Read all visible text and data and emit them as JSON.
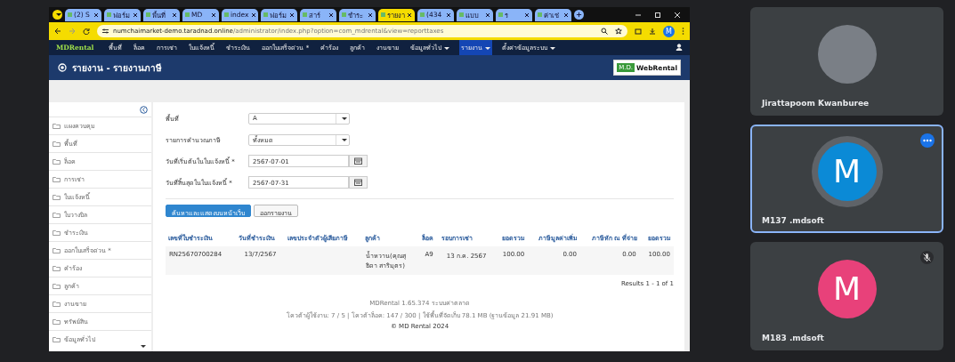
{
  "browser": {
    "tabs": [
      {
        "label": "(2) S",
        "selected": false
      },
      {
        "label": "ฟอร์ม",
        "selected": false
      },
      {
        "label": "พื้นที่",
        "selected": false
      },
      {
        "label": "MD",
        "selected": false
      },
      {
        "label": "index",
        "selected": false
      },
      {
        "label": "ฟอร์ม",
        "selected": false
      },
      {
        "label": "สาร์",
        "selected": false
      },
      {
        "label": "ชำระ",
        "selected": false
      },
      {
        "label": "รายงา",
        "selected": true
      },
      {
        "label": "(434",
        "selected": false
      },
      {
        "label": "แบบ",
        "selected": false
      },
      {
        "label": "ร",
        "selected": false
      },
      {
        "label": "ค่าเช่",
        "selected": false
      }
    ],
    "url_host": "numchaimarket-demo.taradnad.online",
    "url_path": "/administrator/index.php?option=com_mdrental&view=reporttaxes",
    "profile_initial": "M"
  },
  "app": {
    "brand": "MDRental",
    "menu": [
      {
        "label": "พื้นที่",
        "dropdown": false,
        "selected": false
      },
      {
        "label": "ล็อค",
        "dropdown": false,
        "selected": false
      },
      {
        "label": "การเช่า",
        "dropdown": false,
        "selected": false
      },
      {
        "label": "ใบแจ้งหนี้",
        "dropdown": false,
        "selected": false
      },
      {
        "label": "ชำระเงิน",
        "dropdown": false,
        "selected": false
      },
      {
        "label": "ออกใบเสร็จด่วน *",
        "dropdown": false,
        "selected": false
      },
      {
        "label": "คำร้อง",
        "dropdown": false,
        "selected": false
      },
      {
        "label": "ลูกค้า",
        "dropdown": false,
        "selected": false
      },
      {
        "label": "งานขาย",
        "dropdown": false,
        "selected": false
      },
      {
        "label": "ข้อมูลทั่วไป",
        "dropdown": true,
        "selected": false
      },
      {
        "label": "รายงาน",
        "dropdown": true,
        "selected": true
      },
      {
        "label": "ตั้งค่าข้อมูลระบบ",
        "dropdown": true,
        "selected": false
      }
    ],
    "page_title": "รายงาน - รายงานภาษี",
    "logo_badge": "M.D.",
    "logo_name": "WebRental"
  },
  "sidebar": {
    "items": [
      "แผงควบคุม",
      "พื้นที่",
      "ล็อค",
      "การเช่า",
      "ใบแจ้งหนี้",
      "ใบวางบิล",
      "ชำระเงิน",
      "ออกใบเสร็จด่วน *",
      "คำร้อง",
      "ลูกค้า",
      "งานขาย",
      "ทรัพย์สิน",
      "ข้อมูลทั่วไป"
    ]
  },
  "form": {
    "fields": [
      {
        "kind": "select",
        "label": "พื้นที่",
        "value": "A"
      },
      {
        "kind": "select",
        "label": "รายการคำนวณภาษี",
        "value": "ทั้งหมด"
      },
      {
        "kind": "date",
        "label": "วันที่เริ่มต้นในใบแจ้งหนี้ *",
        "value": "2567-07-01"
      },
      {
        "kind": "date",
        "label": "วันที่สิ้นสุดในใบแจ้งหนี้ *",
        "value": "2567-07-31"
      }
    ],
    "buttons": [
      {
        "label": "ค้นหาและแสดงบนหน้าเว็บ",
        "primary": true
      },
      {
        "label": "ออกรายงาน",
        "primary": false
      }
    ]
  },
  "table": {
    "columns": [
      "เลขที่ใบชำระเงิน",
      "วันที่ชำระเงิน",
      "เลขประจำตัวผู้เสียภาษี",
      "ลูกค้า",
      "ล็อค",
      "รอบการเช่า",
      "ยอดรวม",
      "ภาษีมูลค่าเพิ่ม",
      "ภาษีหัก ณ ที่จ่าย",
      "ยอดรวม"
    ],
    "rows": [
      [
        "RN25670700284",
        "13/7/2567",
        "",
        "น้ำหวาน(คุณสุธิดา สาริมุตร)",
        "A9",
        "13 ก.ค. 2567",
        "100.00",
        "0.00",
        "0.00",
        "100.00"
      ]
    ],
    "results": "Results 1 - 1 of 1"
  },
  "footer": [
    "MDRental 1.65.374 ระบบค่าตลาด",
    "โควต้าผู้ใช้งาน: 7 / 5 | โควต้าล็อค: 147 / 300 | ใช้พื้นที่จัดเก็บ 78.1 MB (ฐานข้อมูล 21.91 MB)",
    "© MD Rental 2024"
  ],
  "participants": [
    {
      "kind": "photo",
      "name": "Jirattapoom Kwanburee",
      "selected": false,
      "muted": false
    },
    {
      "kind": "initial",
      "initial": "M",
      "color": "#0b8ad6",
      "name": "M137 .mdsoft",
      "selected": true,
      "muted": false
    },
    {
      "kind": "initial",
      "initial": "M",
      "color": "#e8417a",
      "name": "M183 .mdsoft",
      "selected": false,
      "muted": true
    }
  ]
}
